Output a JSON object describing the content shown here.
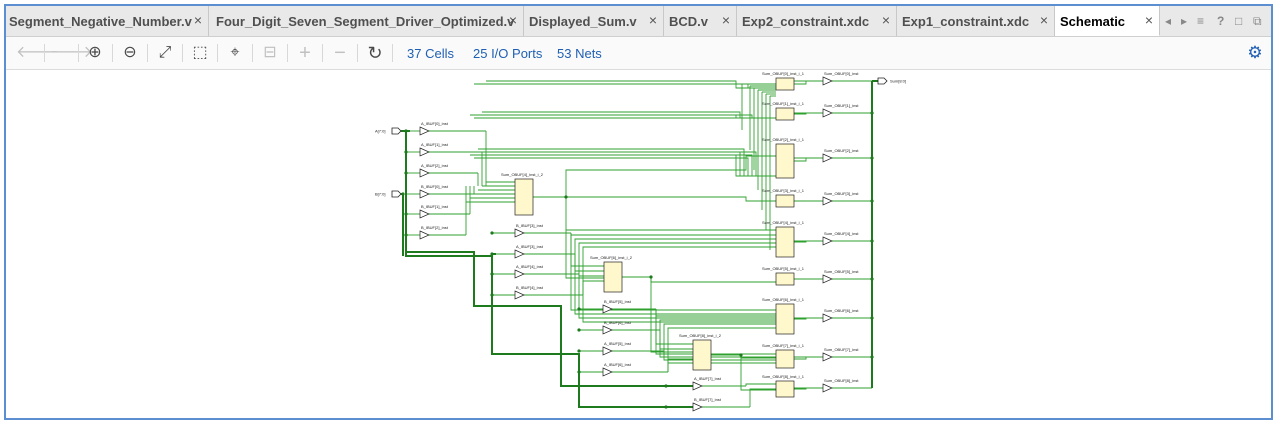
{
  "tabs": [
    {
      "label": "Segment_Negative_Number.v",
      "active": false
    },
    {
      "label": "Four_Digit_Seven_Segment_Driver_Optimized.v",
      "active": false
    },
    {
      "label": "Displayed_Sum.v",
      "active": false
    },
    {
      "label": "BCD.v",
      "active": false
    },
    {
      "label": "Exp2_constraint.xdc",
      "active": false
    },
    {
      "label": "Exp1_constraint.xdc",
      "active": false
    },
    {
      "label": "Schematic",
      "active": true
    }
  ],
  "tab_close_glyph": "×",
  "tab_controls": {
    "prev": "◂",
    "next": "▸",
    "list": "≡",
    "help": "?",
    "maximize": "□",
    "float": "⧉"
  },
  "toolbar": {
    "back": "🡐",
    "forward": "🡒",
    "zoom_in": "⊕",
    "zoom_out": "⊖",
    "fit": "⤢",
    "zoom_area": "⬚",
    "center": "⌖",
    "collapse": "⊟",
    "add": "+",
    "remove": "−",
    "refresh": "↻",
    "cells": "37 Cells",
    "io_ports": "25 I/O Ports",
    "nets": "53 Nets",
    "settings": "⚙"
  },
  "schematic": {
    "input_ports": [
      "A[7:0]",
      "B[7:0]"
    ],
    "output_port": "Sum[8:0]",
    "ibufs_a": [
      "A_IBUF[0]_inst",
      "A_IBUF[1]_inst",
      "A_IBUF[2]_inst",
      "A_IBUF[3]_inst",
      "A_IBUF[4]_inst",
      "A_IBUF[5]_inst",
      "A_IBUF[6]_inst",
      "A_IBUF[7]_inst"
    ],
    "ibufs_b": [
      "B_IBUF[0]_inst",
      "B_IBUF[1]_inst",
      "B_IBUF[2]_inst",
      "B_IBUF[3]_inst",
      "B_IBUF[4]_inst",
      "B_IBUF[5]_inst",
      "B_IBUF[6]_inst",
      "B_IBUF[7]_inst"
    ],
    "luts": [
      "Sum_OBUF[0]_inst_i_1",
      "Sum_OBUF[1]_inst_i_1",
      "Sum_OBUF[2]_inst_i_1",
      "Sum_OBUF[4]_inst_i_2",
      "Sum_OBUF[3]_inst_i_1",
      "Sum_OBUF[4]_inst_i_1",
      "Sum_OBUF[6]_inst_i_2",
      "Sum_OBUF[5]_inst_i_1",
      "Sum_OBUF[6]_inst_i_1",
      "Sum_OBUF[8]_inst_i_2",
      "Sum_OBUF[7]_inst_i_1",
      "Sum_OBUF[8]_inst_i_1"
    ],
    "obufs": [
      "Sum_OBUF[0]_inst",
      "Sum_OBUF[1]_inst",
      "Sum_OBUF[2]_inst",
      "Sum_OBUF[3]_inst",
      "Sum_OBUF[4]_inst",
      "Sum_OBUF[5]_inst",
      "Sum_OBUF[6]_inst",
      "Sum_OBUF[7]_inst",
      "Sum_OBUF[8]_inst"
    ]
  }
}
